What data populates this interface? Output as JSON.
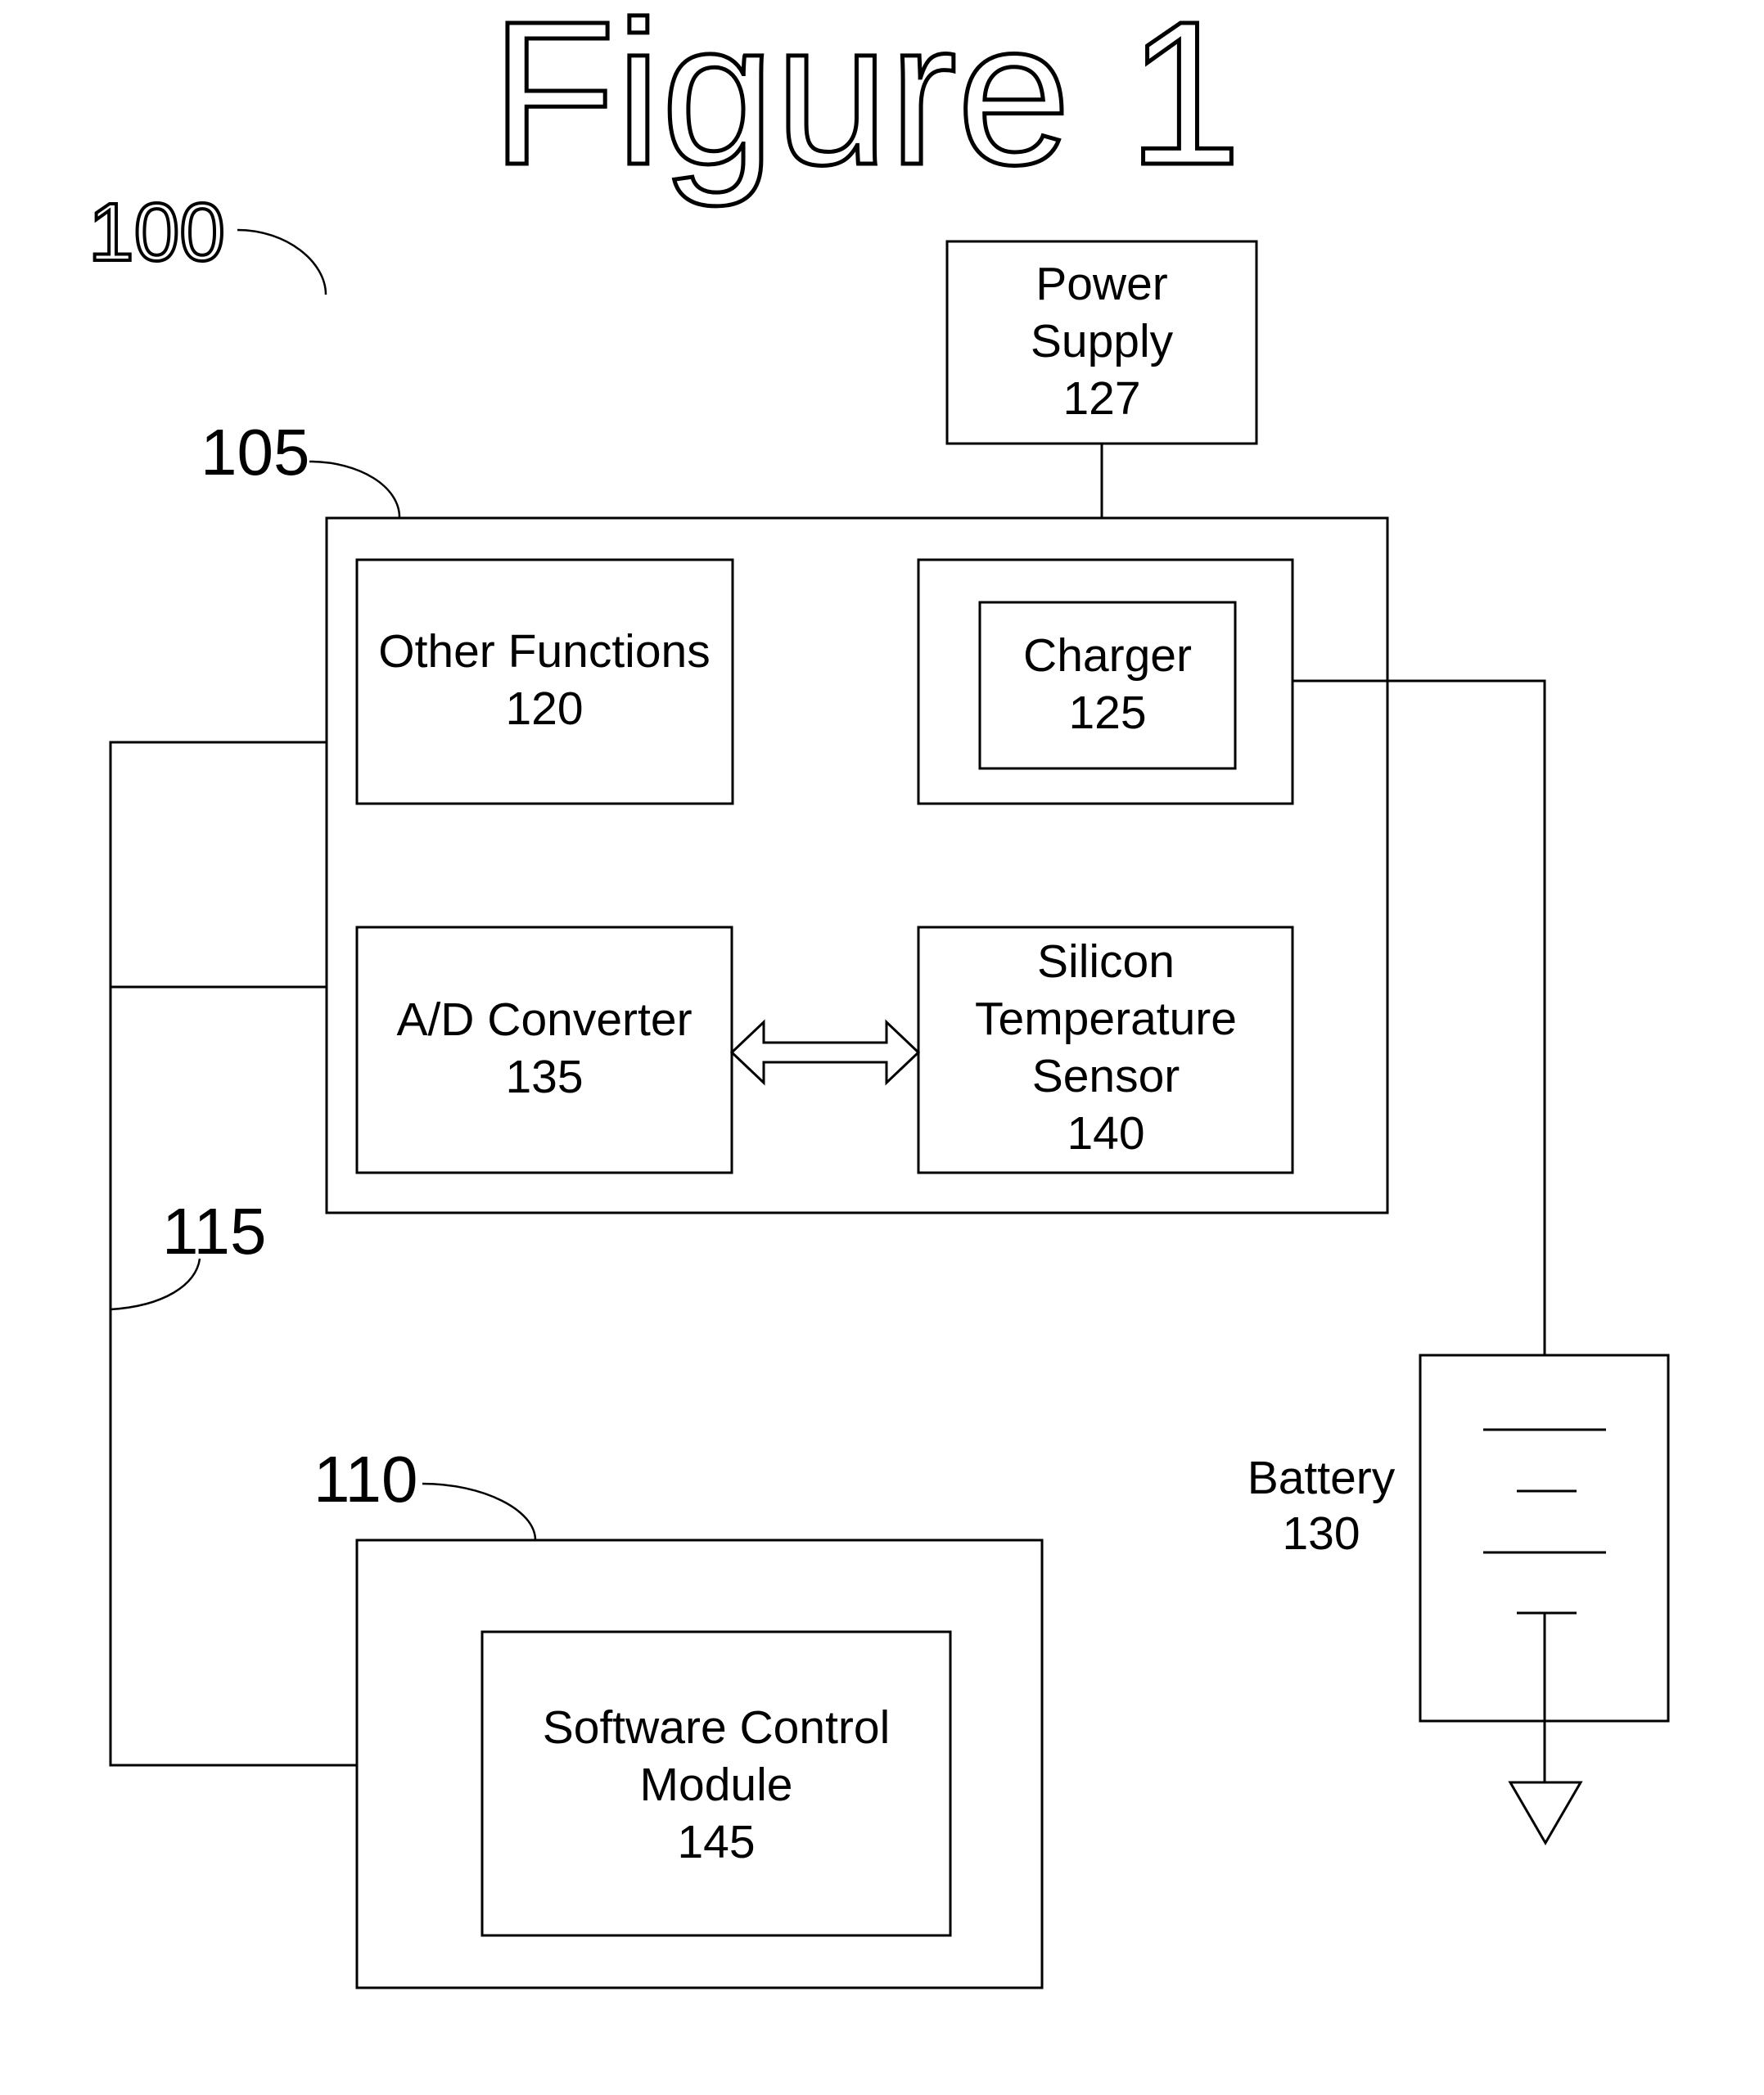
{
  "figure": {
    "title": "Figure 1",
    "reference_labels": {
      "system": "100",
      "hardware_module": "105",
      "bus": "115",
      "software_module": "110"
    },
    "blocks": {
      "power_supply": {
        "lines": [
          "Power",
          "Supply",
          "127"
        ]
      },
      "other_functions": {
        "lines": [
          "Other Functions",
          "120"
        ]
      },
      "charger": {
        "lines": [
          "Charger",
          "125"
        ]
      },
      "ad_converter": {
        "lines": [
          "A/D Converter",
          "135"
        ]
      },
      "temperature_sensor": {
        "lines": [
          "Silicon",
          "Temperature",
          "Sensor",
          "140"
        ]
      },
      "software_control": {
        "lines": [
          "Software Control",
          "Module",
          "145"
        ]
      },
      "battery": {
        "lines": [
          "Battery",
          "130"
        ]
      }
    },
    "connections": [
      {
        "from": "power_supply",
        "to": "hardware_module"
      },
      {
        "from": "charger",
        "to": "battery"
      },
      {
        "from": "ad_converter",
        "to": "temperature_sensor",
        "type": "bidirectional-arrow"
      },
      {
        "from": "bus",
        "to": "other_functions"
      },
      {
        "from": "bus",
        "to": "ad_converter"
      },
      {
        "from": "bus",
        "to": "software_module"
      },
      {
        "from": "battery",
        "to": "ground"
      }
    ]
  }
}
